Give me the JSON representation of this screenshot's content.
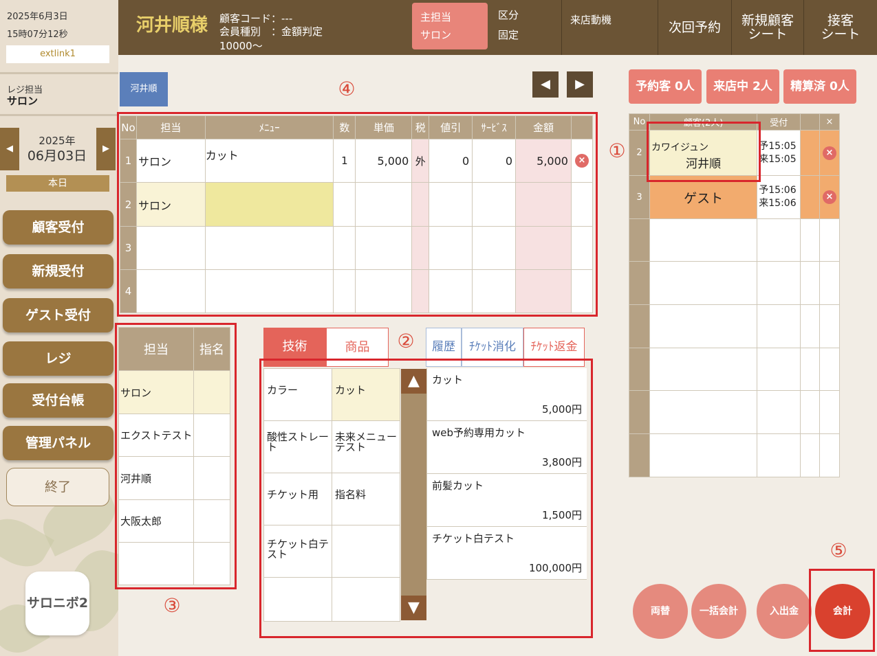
{
  "sidebar": {
    "date": "2025年6月3日",
    "time": "15時07分12秒",
    "extlink": "extlink1",
    "register_label": "レジ担当",
    "register_value": "サロン",
    "prev_arrow": "◀",
    "next_arrow": "▶",
    "date_year": "2025年",
    "date_day": "06月03日",
    "today": "本日",
    "buttons": [
      "顧客受付",
      "新規受付",
      "ゲスト受付",
      "レジ",
      "受付台帳",
      "管理パネル"
    ],
    "end": "終了",
    "logo": "サロニボ2"
  },
  "header": {
    "customer_name": "河井順様",
    "code_label": "顧客コード：---",
    "type_label": "会員種別　：金額判定",
    "type_value": "10000〜",
    "main_staff_label": "主担当",
    "main_staff_value": "サロン",
    "kubun_label": "区分",
    "kubun_value": "固定",
    "visit_motive": "来店動機",
    "next_reservation": "次回予約",
    "new_customer_sheet": [
      "新規顧客",
      "シート"
    ],
    "service_sheet": [
      "接客",
      "シート"
    ]
  },
  "staff_tag": "河井順",
  "nav": {
    "prev": "◀",
    "next": "▶"
  },
  "annotations": [
    "①",
    "②",
    "③",
    "④",
    "⑤"
  ],
  "main_table": {
    "headers": [
      "No",
      "担当",
      "ﾒﾆｭｰ",
      "数",
      "単価",
      "税",
      "値引",
      "ｻｰﾋﾞｽ",
      "金額"
    ],
    "rows": [
      {
        "no": "1",
        "staff": "サロン",
        "menu": "カット",
        "qty": "1",
        "price": "5,000",
        "tax": "外",
        "discount": "0",
        "service": "0",
        "amount": "5,000",
        "remove": "×"
      },
      {
        "no": "2",
        "staff": "サロン",
        "menu": "",
        "qty": "",
        "price": "",
        "tax": "",
        "discount": "",
        "service": "",
        "amount": "",
        "remove": ""
      },
      {
        "no": "3",
        "staff": "",
        "menu": "",
        "qty": "",
        "price": "",
        "tax": "",
        "discount": "",
        "service": "",
        "amount": "",
        "remove": ""
      },
      {
        "no": "4",
        "staff": "",
        "menu": "",
        "qty": "",
        "price": "",
        "tax": "",
        "discount": "",
        "service": "",
        "amount": "",
        "remove": ""
      }
    ]
  },
  "queue": {
    "reserved": "予約客 0人",
    "visiting": "来店中 2人",
    "paid": "精算済 0人",
    "headers": [
      "No",
      "顧客(2人)",
      "受付",
      "",
      "×"
    ],
    "rows": [
      {
        "no": "2",
        "kana": "カワイジュン",
        "name": "河井順",
        "reserve": "予15:05",
        "arrive": "来15:05",
        "remove": "×"
      },
      {
        "no": "3",
        "kana": "",
        "name": "ゲスト",
        "reserve": "予15:06",
        "arrive": "来15:06",
        "remove": "×"
      }
    ]
  },
  "staff_panel": {
    "headers": [
      "担当",
      "指名"
    ],
    "rows": [
      "サロン",
      "エクストテスト",
      "河井順",
      "大阪太郎",
      ""
    ]
  },
  "tabs": {
    "technique": "技術",
    "product": "商品",
    "history": "履歴",
    "ticket_use": "ﾁｹｯﾄ消化",
    "ticket_return": "ﾁｹｯﾄ返金"
  },
  "categories": [
    [
      "カラー",
      "カット"
    ],
    [
      "酸性ストレート",
      "未来メニューテスト"
    ],
    [
      "チケット用",
      "指名料"
    ],
    [
      "チケット白テスト",
      ""
    ],
    [
      "",
      ""
    ]
  ],
  "scroll": {
    "up": "▲",
    "down": "▼"
  },
  "items": [
    {
      "name": "カット",
      "price": "5,000円"
    },
    {
      "name": "web予約専用カット",
      "price": "3,800円"
    },
    {
      "name": "前髪カット",
      "price": "1,500円"
    },
    {
      "name": "チケット白テスト",
      "price": "100,000円"
    }
  ],
  "actions": {
    "exchange": "両替",
    "bulk": "一括会計",
    "cash_in_out": "入出金",
    "checkout": "会計"
  },
  "colors": {
    "header_bg": "#6b5435",
    "accent_gold": "#e8cf6a",
    "sidebar_button": "#9a7640",
    "highlight_red": "#d8262c",
    "queue_orange": "#f2ab6e",
    "checkout_red": "#d9412e"
  }
}
